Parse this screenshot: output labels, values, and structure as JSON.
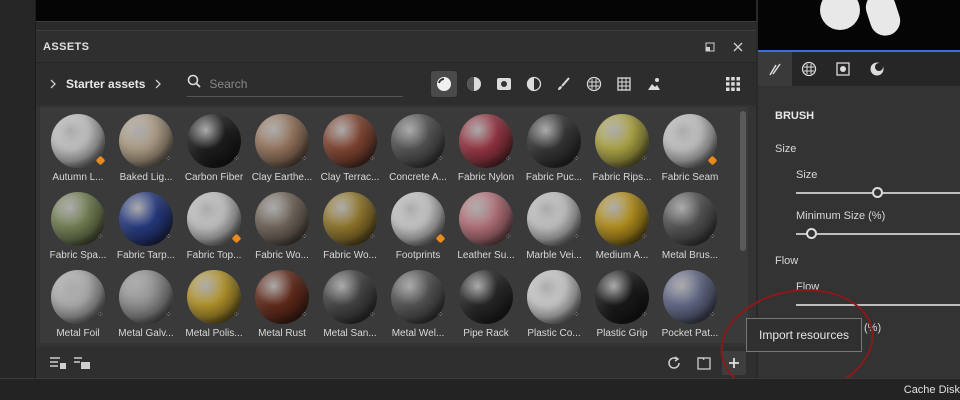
{
  "panel": {
    "title": "ASSETS"
  },
  "breadcrumb": {
    "label": "Starter assets"
  },
  "search": {
    "placeholder": "Search"
  },
  "assets": [
    {
      "label": "Autumn L...",
      "color": "#cfcfcf",
      "badge": "orange"
    },
    {
      "label": "Baked Lig...",
      "color": "#b9a88f",
      "badge": "dots"
    },
    {
      "label": "Carbon Fiber",
      "color": "#202020",
      "badge": "dots"
    },
    {
      "label": "Clay Earthe...",
      "color": "#a27f66",
      "badge": "dots"
    },
    {
      "label": "Clay Terrac...",
      "color": "#8a4a36",
      "badge": "dots"
    },
    {
      "label": "Concrete A...",
      "color": "#5a5a5c",
      "badge": "dots"
    },
    {
      "label": "Fabric Nylon",
      "color": "#a03a48",
      "badge": "dots"
    },
    {
      "label": "Fabric Puc...",
      "color": "#3a3a3a",
      "badge": "dots"
    },
    {
      "label": "Fabric Rips...",
      "color": "#b8b04a",
      "badge": "dots"
    },
    {
      "label": "Fabric Seam",
      "color": "#cfcfcf",
      "badge": "orange"
    },
    {
      "label": "Fabric Spa...",
      "color": "#7b8a5a",
      "badge": "dots"
    },
    {
      "label": "Fabric Tarp...",
      "color": "#2a3f8a",
      "badge": "dots"
    },
    {
      "label": "Fabric Top...",
      "color": "#cfcfcf",
      "badge": "orange"
    },
    {
      "label": "Fabric Wo...",
      "color": "#7a6e62",
      "badge": "dots"
    },
    {
      "label": "Fabric Wo...",
      "color": "#9c8030",
      "badge": "dots"
    },
    {
      "label": "Footprints",
      "color": "#d4d4d4",
      "badge": "orange"
    },
    {
      "label": "Leather Su...",
      "color": "#c07a82",
      "badge": "dots"
    },
    {
      "label": "Marble Vei...",
      "color": "#d0d0d0",
      "badge": "dots"
    },
    {
      "label": "Medium A...",
      "color": "#c09a20",
      "badge": "dots"
    },
    {
      "label": "Metal Brus...",
      "color": "#5a5a5a",
      "badge": "dots"
    },
    {
      "label": "Metal Foil",
      "color": "#b8b8b8",
      "badge": "dots"
    },
    {
      "label": "Metal Galv...",
      "color": "#9a9a9a",
      "badge": "dots"
    },
    {
      "label": "Metal Polis...",
      "color": "#c0a030",
      "badge": "dots"
    },
    {
      "label": "Metal Rust",
      "color": "#6a2e1e",
      "badge": "dots"
    },
    {
      "label": "Metal San...",
      "color": "#4a4a4a",
      "badge": "dots"
    },
    {
      "label": "Metal Wel...",
      "color": "#5a5a5a",
      "badge": "dots"
    },
    {
      "label": "Pipe Rack",
      "color": "#2a2a2a",
      "badge": "none"
    },
    {
      "label": "Plastic Co...",
      "color": "#d8d8d8",
      "badge": "dots"
    },
    {
      "label": "Plastic Grip",
      "color": "#1c1c1c",
      "badge": "dots"
    },
    {
      "label": "Pocket Pat...",
      "color": "#6a7090",
      "badge": "dots"
    }
  ],
  "tooltip": {
    "text": "Import resources"
  },
  "brush": {
    "title": "BRUSH",
    "size_section": "Size",
    "size_label": "Size",
    "size_value": 0.5,
    "min_size_label": "Minimum Size (%)",
    "min_size_value": 0.1,
    "flow_section": "Flow",
    "flow_label": "Flow",
    "partial_label": "(%)"
  },
  "status": {
    "text": "Cache Disk"
  },
  "colors": {
    "accent": "#3a6fd8",
    "badge": "#e8891e",
    "annotation": "#8a1a1a"
  }
}
